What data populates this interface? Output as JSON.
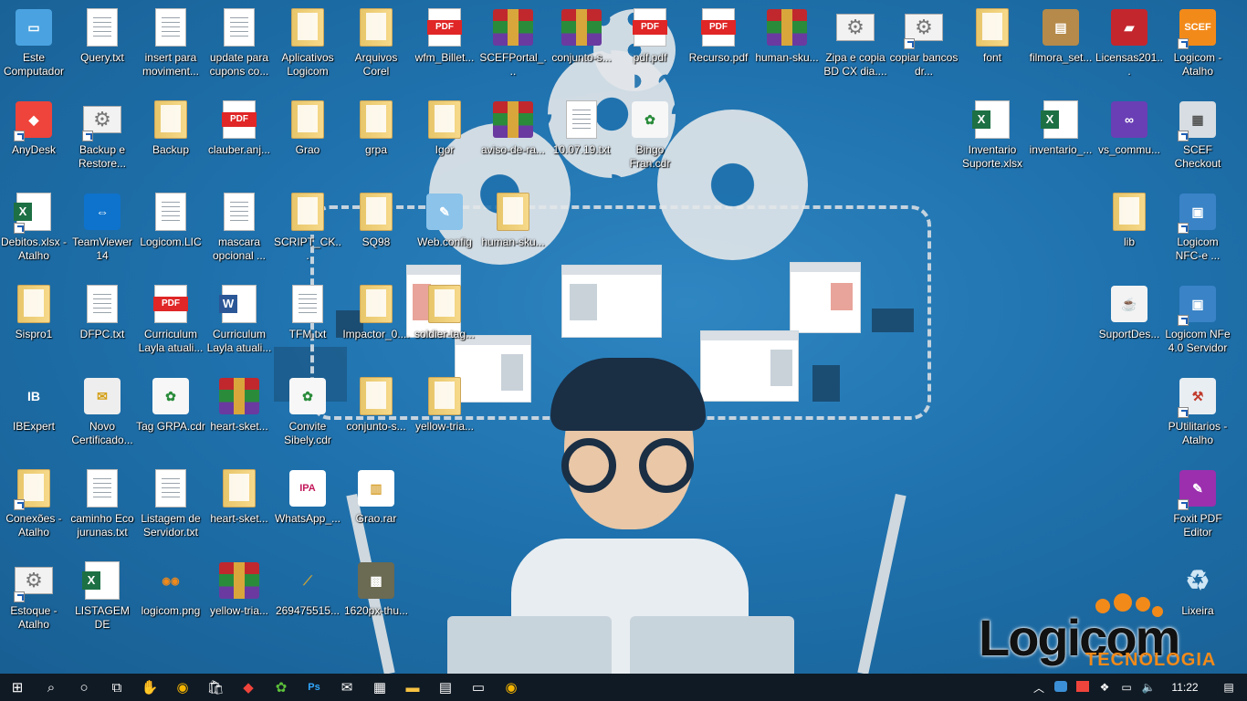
{
  "desktop_icons": [
    {
      "label": "Este Computador",
      "type": "pc",
      "col": 0,
      "row": 0
    },
    {
      "label": "Query.txt",
      "type": "txt",
      "col": 1,
      "row": 0
    },
    {
      "label": "insert para moviment...",
      "type": "txt",
      "col": 2,
      "row": 0
    },
    {
      "label": "update para cupons co...",
      "type": "txt",
      "col": 3,
      "row": 0
    },
    {
      "label": "Aplicativos Logicom",
      "type": "folder",
      "col": 4,
      "row": 0
    },
    {
      "label": "Arquivos Corel",
      "type": "folder",
      "col": 5,
      "row": 0
    },
    {
      "label": "wfm_Billet...",
      "type": "pdf",
      "col": 6,
      "row": 0
    },
    {
      "label": "SCEFPortal_...",
      "type": "rar",
      "col": 7,
      "row": 0
    },
    {
      "label": "conjunto-s...",
      "type": "rar",
      "col": 8,
      "row": 0
    },
    {
      "label": "pdf.pdf",
      "type": "pdf",
      "col": 9,
      "row": 0
    },
    {
      "label": "Recurso.pdf",
      "type": "pdf",
      "col": 10,
      "row": 0
    },
    {
      "label": "human-sku...",
      "type": "rar",
      "col": 11,
      "row": 0
    },
    {
      "label": "Zipa e copia BD CX dia....",
      "type": "gear",
      "col": 12,
      "row": 0
    },
    {
      "label": "copiar bancos dr...",
      "type": "gear",
      "col": 13,
      "row": 0,
      "shortcut": true
    },
    {
      "label": "font",
      "type": "folder",
      "col": 14,
      "row": 0
    },
    {
      "label": "filmora_set...",
      "type": "setup",
      "col": 15,
      "row": 0
    },
    {
      "label": "Licensas201...",
      "type": "red",
      "col": 16,
      "row": 0
    },
    {
      "label": "Logicom - Atalho",
      "type": "scef",
      "col": 17,
      "row": 0,
      "shortcut": true
    },
    {
      "label": "AnyDesk",
      "type": "anydesk",
      "col": 0,
      "row": 1,
      "shortcut": true
    },
    {
      "label": "Backup e Restore...",
      "type": "gear",
      "col": 1,
      "row": 1,
      "shortcut": true
    },
    {
      "label": "Backup",
      "type": "folder",
      "col": 2,
      "row": 1
    },
    {
      "label": "clauber.anj...",
      "type": "pdf",
      "col": 3,
      "row": 1
    },
    {
      "label": "Grao",
      "type": "folder",
      "col": 4,
      "row": 1
    },
    {
      "label": "grpa",
      "type": "folder",
      "col": 5,
      "row": 1
    },
    {
      "label": "Igor",
      "type": "folder",
      "col": 6,
      "row": 1
    },
    {
      "label": "aviso-de-ra...",
      "type": "rar",
      "col": 7,
      "row": 1
    },
    {
      "label": "10.07.19.txt",
      "type": "txt",
      "col": 8,
      "row": 1
    },
    {
      "label": "Bingo Fran.cdr",
      "type": "cdr",
      "col": 9,
      "row": 1
    },
    {
      "label": "Inventario Suporte.xlsx",
      "type": "xls",
      "col": 14,
      "row": 1
    },
    {
      "label": "inventario_...",
      "type": "xls",
      "col": 15,
      "row": 1
    },
    {
      "label": "vs_commu...",
      "type": "vs",
      "col": 16,
      "row": 1
    },
    {
      "label": "SCEF Checkout",
      "type": "register",
      "col": 17,
      "row": 1,
      "shortcut": true
    },
    {
      "label": "Debitos.xlsx - Atalho",
      "type": "xls",
      "col": 0,
      "row": 2,
      "shortcut": true
    },
    {
      "label": "TeamViewer 14",
      "type": "teamviewer",
      "col": 1,
      "row": 2
    },
    {
      "label": "Logicom.LIC",
      "type": "lic",
      "col": 2,
      "row": 2
    },
    {
      "label": "mascara opcional ...",
      "type": "txt",
      "col": 3,
      "row": 2
    },
    {
      "label": "SCRIPT_CK...",
      "type": "folder",
      "col": 4,
      "row": 2
    },
    {
      "label": "SQ98",
      "type": "folder",
      "col": 5,
      "row": 2
    },
    {
      "label": "Web.config",
      "type": "notepad",
      "col": 6,
      "row": 2
    },
    {
      "label": "human-sku...",
      "type": "folder",
      "col": 7,
      "row": 2
    },
    {
      "label": "lib",
      "type": "folder",
      "col": 16,
      "row": 2
    },
    {
      "label": "Logicom NFC-e ...",
      "type": "monitor",
      "col": 17,
      "row": 2,
      "shortcut": true
    },
    {
      "label": "Sispro1",
      "type": "folder",
      "col": 0,
      "row": 3
    },
    {
      "label": "DFPC.txt",
      "type": "txt",
      "col": 1,
      "row": 3
    },
    {
      "label": "Curriculum Layla atuali...",
      "type": "pdf",
      "col": 2,
      "row": 3
    },
    {
      "label": "Curriculum Layla atuali...",
      "type": "word",
      "col": 3,
      "row": 3
    },
    {
      "label": "TFM.txt",
      "type": "txt",
      "col": 4,
      "row": 3
    },
    {
      "label": "Impactor_0....",
      "type": "folder",
      "col": 5,
      "row": 3
    },
    {
      "label": "soldier-tag...",
      "type": "folder",
      "col": 6,
      "row": 3
    },
    {
      "label": "SuportDes...",
      "type": "java",
      "col": 16,
      "row": 3
    },
    {
      "label": "Logicom NFe 4.0 Servidor",
      "type": "monitor",
      "col": 17,
      "row": 3,
      "shortcut": true
    },
    {
      "label": "IBExpert",
      "type": "ib",
      "col": 0,
      "row": 4
    },
    {
      "label": "Novo Certificado...",
      "type": "cert",
      "col": 1,
      "row": 4
    },
    {
      "label": "Tag GRPA.cdr",
      "type": "cdr",
      "col": 2,
      "row": 4
    },
    {
      "label": "heart-sket...",
      "type": "rar",
      "col": 3,
      "row": 4
    },
    {
      "label": "Convite Sibely.cdr",
      "type": "cdr",
      "col": 4,
      "row": 4
    },
    {
      "label": "conjunto-s...",
      "type": "folder",
      "col": 5,
      "row": 4
    },
    {
      "label": "yellow-tria...",
      "type": "folder",
      "col": 6,
      "row": 4
    },
    {
      "label": "PUtilitarios - Atalho",
      "type": "tools",
      "col": 17,
      "row": 4,
      "shortcut": true
    },
    {
      "label": "Conexões - Atalho",
      "type": "folder",
      "col": 0,
      "row": 5,
      "shortcut": true
    },
    {
      "label": "caminho Eco jurunas.txt",
      "type": "txt",
      "col": 1,
      "row": 5
    },
    {
      "label": "Listagem de Servidor.txt",
      "type": "txt",
      "col": 2,
      "row": 5
    },
    {
      "label": "heart-sket...",
      "type": "folder",
      "col": 3,
      "row": 5
    },
    {
      "label": "WhatsApp_...",
      "type": "ipa",
      "col": 4,
      "row": 5
    },
    {
      "label": "Grao.rar",
      "type": "zip",
      "col": 5,
      "row": 5
    },
    {
      "label": "Foxit PDF Editor",
      "type": "foxit",
      "col": 17,
      "row": 5,
      "shortcut": true
    },
    {
      "label": "Estoque - Atalho",
      "type": "gear",
      "col": 0,
      "row": 6,
      "shortcut": true
    },
    {
      "label": "LISTAGEM DE SERVIDORE...",
      "type": "xls",
      "col": 1,
      "row": 6
    },
    {
      "label": "logicom.png",
      "type": "png",
      "col": 2,
      "row": 6
    },
    {
      "label": "yellow-tria...",
      "type": "rar",
      "col": 3,
      "row": 6
    },
    {
      "label": "269475515...",
      "type": "bullet",
      "col": 4,
      "row": 6
    },
    {
      "label": "1620px-thu...",
      "type": "photo",
      "col": 5,
      "row": 6
    },
    {
      "label": "Lixeira",
      "type": "bin",
      "col": 17,
      "row": 6
    }
  ],
  "brand": {
    "word": "Logicom",
    "tagline": "TECNOLOGIA",
    "accent": "#f28a1a"
  },
  "taskbar": {
    "pinned": [
      "start-icon",
      "search-icon",
      "cortana-icon",
      "task-view-icon",
      "hand-icon",
      "chrome-icon",
      "store-icon",
      "anydesk-icon",
      "corel-icon",
      "photoshop-icon",
      "mail-icon",
      "calculator-icon",
      "explorer-icon",
      "notepad-icon",
      "app-icon",
      "chrome-icon"
    ],
    "clock": "11:22"
  }
}
